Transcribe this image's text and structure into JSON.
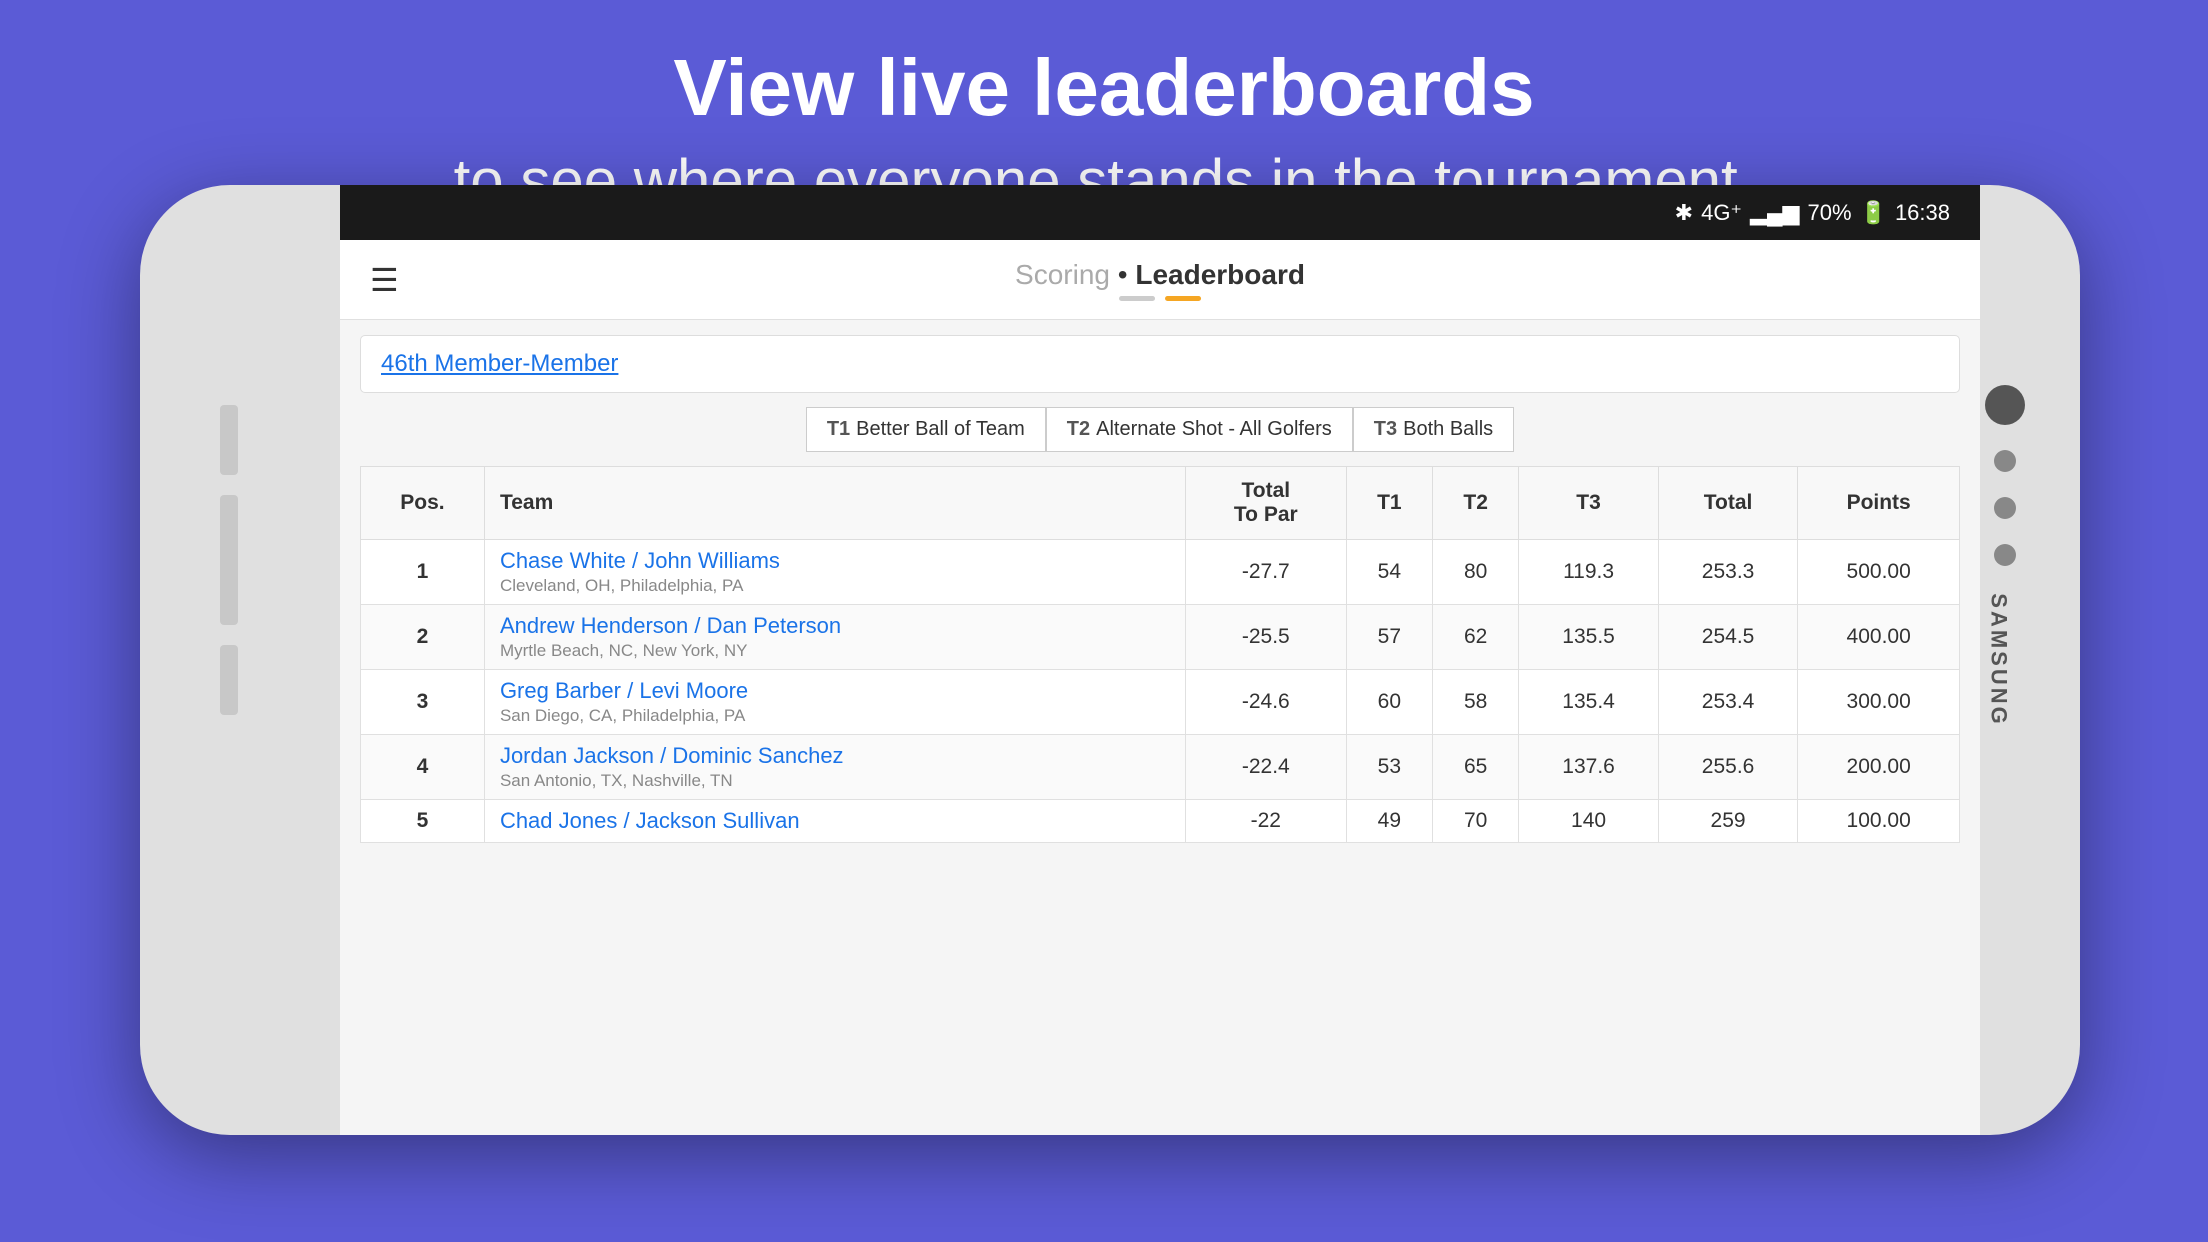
{
  "page": {
    "bg_title": "View live leaderboards",
    "bg_subtitle": "to see where everyone stands in the tournament."
  },
  "status_bar": {
    "battery": "70%",
    "time": "16:38"
  },
  "app_bar": {
    "scoring_label": "Scoring",
    "separator": " • ",
    "leaderboard_label": "Leaderboard"
  },
  "tournament": {
    "name": "46th Member-Member"
  },
  "tab_buttons": [
    {
      "id": "T1",
      "label": "Better Ball of Team"
    },
    {
      "id": "T2",
      "label": "Alternate Shot - All Golfers"
    },
    {
      "id": "T3",
      "label": "Both Balls"
    }
  ],
  "table": {
    "headers": {
      "pos": "Pos.",
      "team": "Team",
      "total_to_par": "Total\nTo Par",
      "t1": "T1",
      "t2": "T2",
      "t3": "T3",
      "total": "Total",
      "points": "Points"
    },
    "rows": [
      {
        "pos": "1",
        "team_name": "Chase White / John Williams",
        "location": "Cleveland, OH, Philadelphia, PA",
        "total_to_par": "-27.7",
        "t1": "54",
        "t2": "80",
        "t3": "119.3",
        "total": "253.3",
        "points": "500.00"
      },
      {
        "pos": "2",
        "team_name": "Andrew Henderson / Dan Peterson",
        "location": "Myrtle Beach, NC, New York, NY",
        "total_to_par": "-25.5",
        "t1": "57",
        "t2": "62",
        "t3": "135.5",
        "total": "254.5",
        "points": "400.00"
      },
      {
        "pos": "3",
        "team_name": "Greg Barber / Levi Moore",
        "location": "San Diego, CA, Philadelphia, PA",
        "total_to_par": "-24.6",
        "t1": "60",
        "t2": "58",
        "t3": "135.4",
        "total": "253.4",
        "points": "300.00"
      },
      {
        "pos": "4",
        "team_name": "Jordan Jackson / Dominic Sanchez",
        "location": "San Antonio, TX, Nashville, TN",
        "total_to_par": "-22.4",
        "t1": "53",
        "t2": "65",
        "t3": "137.6",
        "total": "255.6",
        "points": "200.00"
      },
      {
        "pos": "5",
        "team_name": "Chad Jones / Jackson Sullivan",
        "location": "",
        "total_to_par": "-22",
        "t1": "49",
        "t2": "70",
        "t3": "140",
        "total": "259",
        "points": "100.00"
      }
    ]
  },
  "samsung_text": "SAMSUNG"
}
